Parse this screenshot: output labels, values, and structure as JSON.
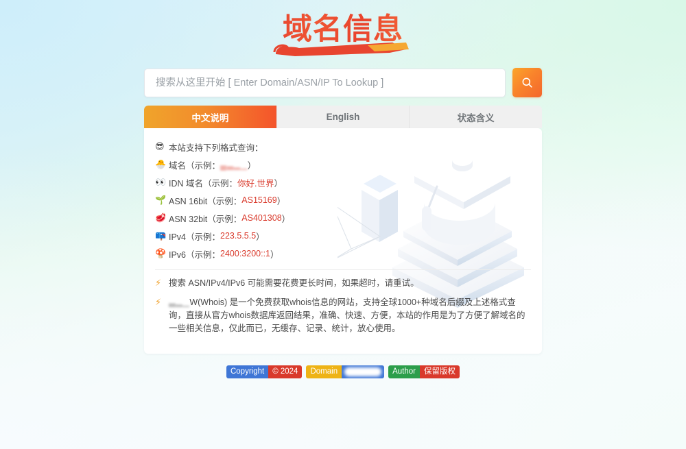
{
  "site": {
    "logo_text": "域名信息"
  },
  "search": {
    "placeholder": "搜索从这里开始 [ Enter Domain/ASN/IP To Lookup ]",
    "value": "",
    "button_icon": "search-icon"
  },
  "tabs": [
    {
      "label": "中文说明",
      "active": true
    },
    {
      "label": "English",
      "active": false
    },
    {
      "label": "状态含义",
      "active": false
    }
  ],
  "formats": {
    "heading_icon": "sunglasses-face-icon",
    "heading": "本站支持下列格式查询：",
    "items": [
      {
        "icon": "chick-icon",
        "label": "域名（示例：",
        "example": "▄▃▂▁",
        "example_redacted": true,
        "suffix": "）"
      },
      {
        "icon": "eyes-icon",
        "label": "IDN 域名（示例：",
        "example": "你好.世界",
        "example_redacted": false,
        "suffix": "）"
      },
      {
        "icon": "seedling-icon",
        "label": "ASN 16bit（示例：",
        "example": "AS15169",
        "example_redacted": false,
        "suffix": "）"
      },
      {
        "icon": "meat-icon",
        "label": "ASN 32bit（示例：",
        "example": "AS401308",
        "example_redacted": false,
        "suffix": "）"
      },
      {
        "icon": "mailbox-icon",
        "label": "IPv4（示例：",
        "example": "223.5.5.5",
        "example_redacted": false,
        "suffix": "）"
      },
      {
        "icon": "mushroom-icon",
        "label": "IPv6（示例：",
        "example": "2400:3200::1",
        "example_redacted": false,
        "suffix": "）"
      }
    ]
  },
  "notes": [
    {
      "icon": "bolt-icon",
      "text": "搜索 ASN/IPv4/IPv6 可能需要花费更长时间，如果超时，请重试。"
    },
    {
      "icon": "bolt-icon",
      "redacted_prefix": "▃▂▁",
      "text": "W(Whois) 是一个免费获取whois信息的网站，支持全球1000+种域名后缀及上述格式查询，直接从官方whois数据库返回结果，准确、快速、方便，本站的作用是为了方便了解域名的一些相关信息，仅此而已，无缓存、记录、统计，放心使用。"
    }
  ],
  "footer": {
    "badges": [
      {
        "name": "copyright-badge",
        "left": "Copyright",
        "right": "© 2024",
        "left_color": "#3f76d6",
        "right_color": "#d9392b",
        "right_redacted": false
      },
      {
        "name": "domain-badge",
        "left": "Domain",
        "right": "",
        "left_color": "#eeb316",
        "right_color": "#3f76d6",
        "right_redacted": true
      },
      {
        "name": "author-badge",
        "left": "Author",
        "right": "保留版权",
        "left_color": "#2c9e4b",
        "right_color": "#d9392b",
        "right_redacted": false
      }
    ]
  },
  "colors": {
    "accent_orange": "#f4662c",
    "accent_orange_light": "#fba52a",
    "example_red": "#d9392b",
    "background_top_left": "#dcf2fa",
    "background_top_right": "#e2f8ec",
    "background_bottom": "#f7fbfd"
  }
}
